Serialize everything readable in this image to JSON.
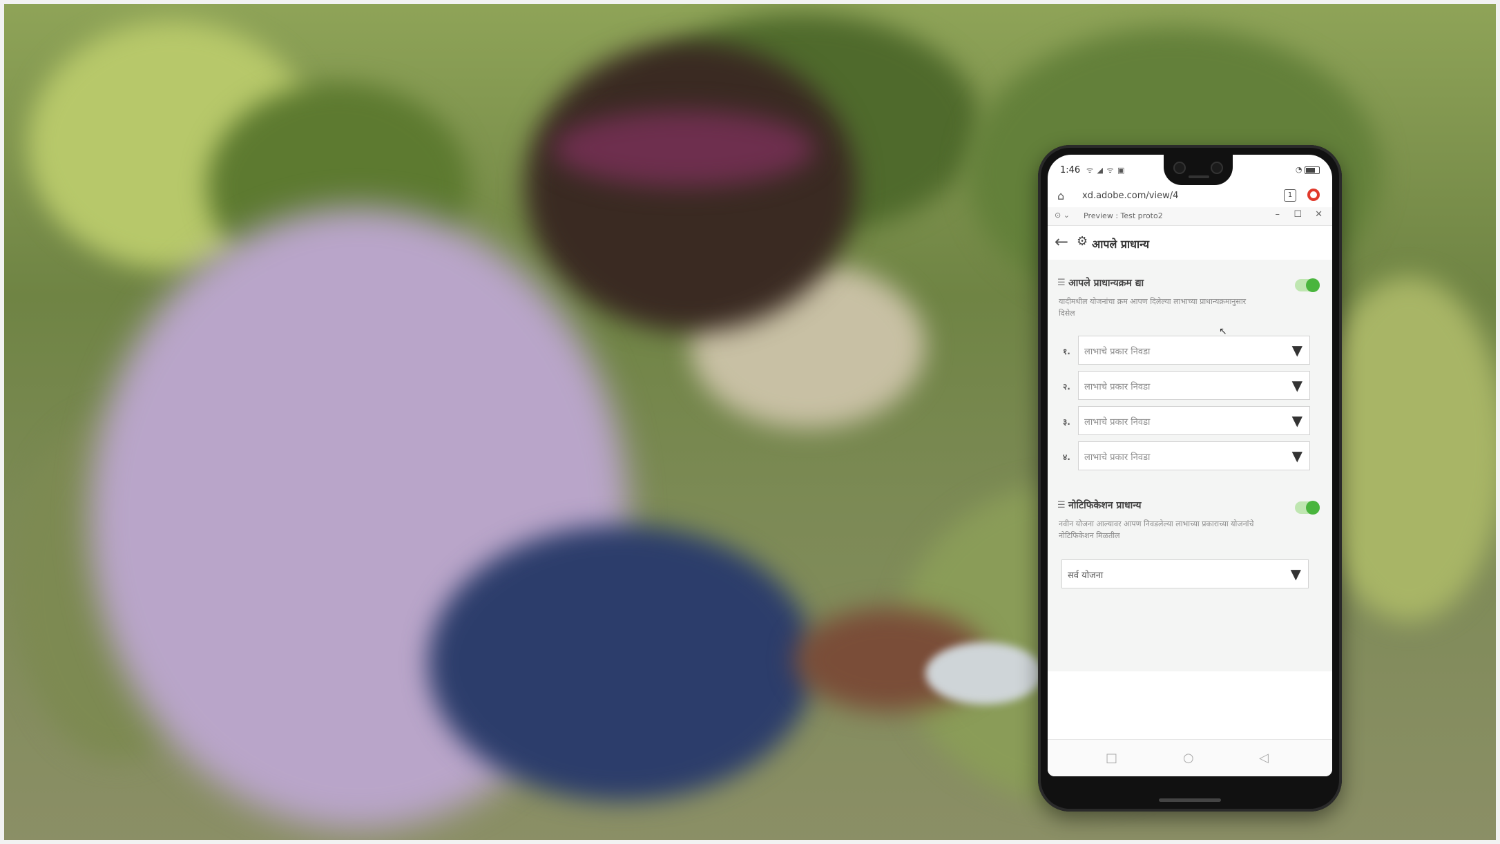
{
  "status_bar": {
    "time": "1:46",
    "left_icons": "ᯤ ◢ ᯤ ▣",
    "right_icons": "◔"
  },
  "browser": {
    "home_icon": "home-icon",
    "url": "xd.adobe.com/view/4",
    "tab_count": "1"
  },
  "preview_bar": {
    "title": "Preview : Test proto2",
    "minimize": "–",
    "maximize": "☐",
    "close": "✕"
  },
  "app": {
    "title": "आपले प्राधान्य",
    "section_priority": {
      "title": "आपले प्राधान्यक्रम द्या",
      "description": "यादीमधील योजनांचा क्रम आपण दिलेल्या लाभाच्या प्राधान्यक्रमानुसार दिसेल",
      "toggle_on": true,
      "rows": [
        {
          "number": "१.",
          "placeholder": "लाभाचे प्रकार निवडा"
        },
        {
          "number": "२.",
          "placeholder": "लाभाचे प्रकार निवडा"
        },
        {
          "number": "३.",
          "placeholder": "लाभाचे प्रकार निवडा"
        },
        {
          "number": "४.",
          "placeholder": "लाभाचे प्रकार निवडा"
        }
      ]
    },
    "section_notification": {
      "title": "नोटिफिकेशन प्राधान्य",
      "description": "नवीन योजना आल्यावर आपण निवडलेल्या लाभाच्या प्रकाराच्या योजनांचे नोटिफिकेशन मिळतील",
      "toggle_on": true,
      "select_value": "सर्व योजना"
    }
  },
  "navbar": {
    "square": "□",
    "circle": "○",
    "back": "◁"
  },
  "colors": {
    "toggle_knob": "#49b53d",
    "toggle_track": "#bfe6b1",
    "browser_accent": "#e0392b"
  }
}
